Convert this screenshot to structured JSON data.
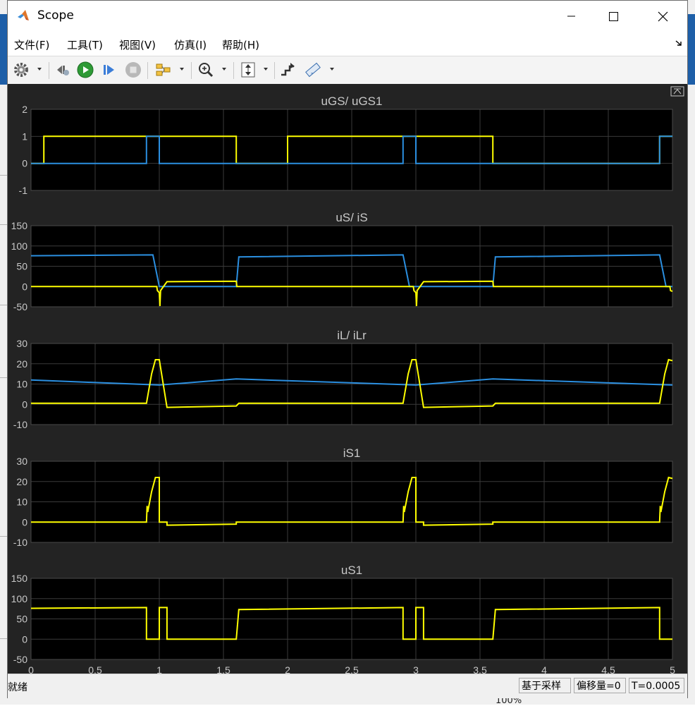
{
  "window": {
    "title": "Scope"
  },
  "menu": [
    "文件(F)",
    "工具(T)",
    "视图(V)",
    "仿真(I)",
    "帮助(H)"
  ],
  "toolbar": [
    "settings-icon",
    "restore-icon",
    "run-icon",
    "step-forward-icon",
    "stop-icon",
    "signal-selector-icon",
    "zoom-icon",
    "autoscale-icon",
    "highlight-block-icon",
    "measure-icon"
  ],
  "status": {
    "text": "就绪",
    "sampling": "基于采样",
    "offset": "偏移量=0",
    "time": "T=0.0005"
  },
  "background": {
    "zoom_text": "100%"
  },
  "x_axis": {
    "ticks": [
      "0",
      "0.5",
      "1",
      "1.5",
      "2",
      "2.5",
      "3",
      "3.5",
      "4",
      "4.5",
      "5"
    ],
    "exponent_base": "×10",
    "exponent": "-5"
  },
  "colors": {
    "series1": "#ffff00",
    "series2": "#2b8fe0",
    "plot_bg": "#000000",
    "panel_bg": "#232323",
    "grid": "#3a3a3a",
    "text": "#c8c8c8"
  },
  "chart_data": [
    {
      "type": "line",
      "title": "uGS/ uGS1",
      "ylim": [
        -1,
        2
      ],
      "yticks": [
        "2",
        "1",
        "0",
        "-1"
      ],
      "xlim": [
        0,
        5e-05
      ],
      "series": [
        {
          "color": "#ffff00",
          "x": [
            0,
            1e-06,
            1e-06,
            1.6e-05,
            1.6e-05,
            2e-05,
            2e-05,
            3.6e-05,
            3.6e-05,
            4.9e-05,
            4.9e-05,
            5e-05
          ],
          "y": [
            0,
            0,
            1,
            1,
            0,
            0,
            1,
            1,
            0,
            0,
            1,
            1
          ]
        },
        {
          "color": "#2b8fe0",
          "x": [
            0,
            9e-06,
            9e-06,
            1e-05,
            1e-05,
            2.9e-05,
            2.9e-05,
            3e-05,
            3e-05,
            4.9e-05,
            4.9e-05,
            5e-05
          ],
          "y": [
            0,
            0,
            1,
            1,
            0,
            0,
            1,
            1,
            0,
            0,
            1,
            1
          ]
        }
      ]
    },
    {
      "type": "line",
      "title": "uS/ iS",
      "ylim": [
        -50,
        150
      ],
      "yticks": [
        "150",
        "100",
        "50",
        "0",
        "-50"
      ],
      "xlim": [
        0,
        5e-05
      ],
      "series": [
        {
          "color": "#2b8fe0",
          "x": [
            0,
            9.5e-06,
            1e-05,
            1.015e-05,
            1.6e-05,
            1.62e-05,
            2.9e-05,
            2.95e-05,
            3e-05,
            3.6e-05,
            3.62e-05,
            4.9e-05,
            4.95e-05,
            5e-05
          ],
          "y": [
            76,
            78,
            0,
            0,
            0,
            73,
            78,
            0,
            0,
            0,
            73,
            78,
            0,
            0
          ]
        },
        {
          "color": "#ffff00",
          "x": [
            0,
            9.8e-06,
            9.85e-06,
            1e-05,
            1.005e-05,
            1.01e-05,
            1.06e-05,
            1.6e-05,
            1.605e-05,
            2.98e-05,
            2.985e-05,
            3e-05,
            3.005e-05,
            3.01e-05,
            3.06e-05,
            3.6e-05,
            3.605e-05,
            4.98e-05,
            4.985e-05,
            5e-05
          ],
          "y": [
            0,
            0,
            -10,
            -15,
            -48,
            -10,
            12,
            13,
            0,
            0,
            -10,
            -15,
            -48,
            -10,
            12,
            13,
            0,
            0,
            -10,
            -12
          ]
        }
      ]
    },
    {
      "type": "line",
      "title": "iL/ iLr",
      "ylim": [
        -10,
        30
      ],
      "yticks": [
        "30",
        "20",
        "10",
        "0",
        "-10"
      ],
      "xlim": [
        0,
        5e-05
      ],
      "series": [
        {
          "color": "#2b8fe0",
          "x": [
            0,
            1e-05,
            1.6e-05,
            3e-05,
            3.6e-05,
            5e-05
          ],
          "y": [
            12,
            9.5,
            12.5,
            9.5,
            12.5,
            9.5
          ]
        },
        {
          "color": "#ffff00",
          "x": [
            0,
            9e-06,
            9.4e-06,
            9.7e-06,
            1e-05,
            1.06e-05,
            1.6e-05,
            1.62e-05,
            2.9e-05,
            2.94e-05,
            2.97e-05,
            3e-05,
            3.06e-05,
            3.6e-05,
            3.62e-05,
            4.9e-05,
            4.94e-05,
            4.97e-05,
            5e-05
          ],
          "y": [
            0.5,
            0.5,
            15,
            22,
            22,
            -1.5,
            -0.8,
            0.5,
            0.5,
            15,
            22,
            22,
            -1.5,
            -0.8,
            0.5,
            0.5,
            15,
            22,
            21.5
          ]
        }
      ]
    },
    {
      "type": "line",
      "title": "iS1",
      "ylim": [
        -10,
        30
      ],
      "yticks": [
        "30",
        "20",
        "10",
        "0",
        "-10"
      ],
      "xlim": [
        0,
        5e-05
      ],
      "series": [
        {
          "color": "#ffff00",
          "x": [
            0,
            9e-06,
            9.05e-06,
            9.1e-06,
            9.4e-06,
            9.7e-06,
            1e-05,
            1e-05,
            1.06e-05,
            1.06e-05,
            1.6e-05,
            1.6e-05,
            2.9e-05,
            2.905e-05,
            2.91e-05,
            2.94e-05,
            2.97e-05,
            3e-05,
            3e-05,
            3.06e-05,
            3.06e-05,
            3.6e-05,
            3.6e-05,
            4.9e-05,
            4.905e-05,
            4.91e-05,
            4.94e-05,
            4.97e-05,
            5e-05
          ],
          "y": [
            0,
            0,
            8,
            5,
            15,
            22,
            22,
            0,
            0,
            -1.5,
            -1,
            0,
            0,
            8,
            5,
            15,
            22,
            22,
            0,
            0,
            -1.5,
            -1,
            0,
            0,
            8,
            5,
            15,
            22,
            21.5
          ]
        }
      ]
    },
    {
      "type": "line",
      "title": "uS1",
      "ylim": [
        -50,
        150
      ],
      "yticks": [
        "150",
        "100",
        "50",
        "0",
        "-50"
      ],
      "xlim": [
        0,
        5e-05
      ],
      "series": [
        {
          "color": "#ffff00",
          "x": [
            0,
            9e-06,
            9e-06,
            1e-05,
            1e-05,
            1.06e-05,
            1.06e-05,
            1.6e-05,
            1.62e-05,
            2.9e-05,
            2.9e-05,
            3e-05,
            3e-05,
            3.06e-05,
            3.06e-05,
            3.6e-05,
            3.62e-05,
            4.9e-05,
            4.9e-05,
            5e-05
          ],
          "y": [
            76,
            78,
            0,
            0,
            78,
            78,
            0,
            0,
            73,
            78,
            0,
            0,
            78,
            78,
            0,
            0,
            73,
            78,
            0,
            0
          ]
        }
      ]
    }
  ]
}
